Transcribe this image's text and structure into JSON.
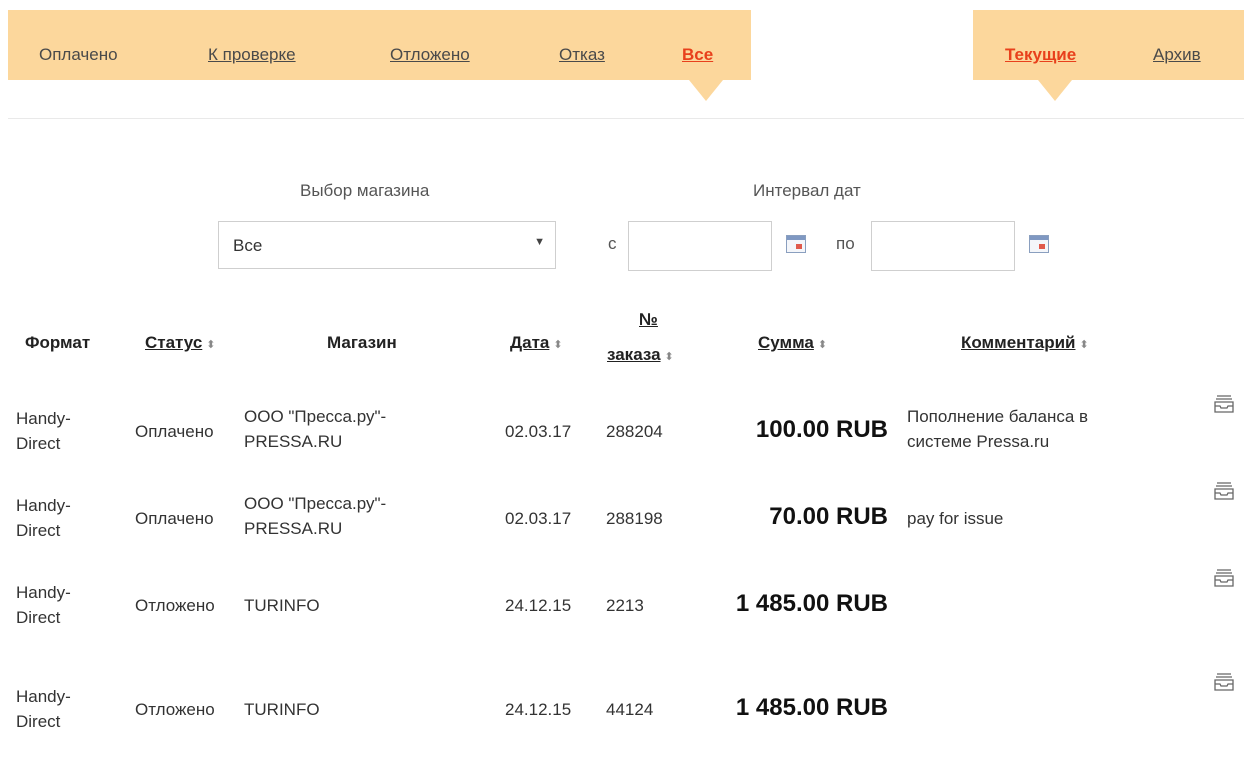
{
  "status_tabs": [
    {
      "label": "Оплачено",
      "active": false
    },
    {
      "label": "К проверке",
      "active": false
    },
    {
      "label": "Отложено",
      "active": false
    },
    {
      "label": "Отказ",
      "active": false
    },
    {
      "label": "Все",
      "active": true
    }
  ],
  "period_tabs": [
    {
      "label": "Текущие",
      "active": true
    },
    {
      "label": "Архив",
      "active": false
    }
  ],
  "filters": {
    "shop_label": "Выбор магазина",
    "shop_value": "Все",
    "date_label": "Интервал дат",
    "from_label": "с",
    "to_label": "по",
    "from_value": "",
    "to_value": ""
  },
  "table": {
    "headers": {
      "format": "Формат",
      "status": "Статус",
      "shop": "Магазин",
      "date": "Дата",
      "order_line1": "№",
      "order_line2": "заказа",
      "sum": "Сумма",
      "comment": "Комментарий"
    },
    "sort_icon": "⬍",
    "rows": [
      {
        "format": [
          "Handy-",
          "Direct"
        ],
        "status": "Оплачено",
        "shop": [
          "ООО \"Пресса.ру\"-",
          "PRESSA.RU"
        ],
        "date": "02.03.17",
        "order": "288204",
        "sum": "100.00 RUB",
        "comment": [
          "Пополнение баланса в",
          "системе Pressa.ru"
        ]
      },
      {
        "format": [
          "Handy-",
          "Direct"
        ],
        "status": "Оплачено",
        "shop": [
          "ООО \"Пресса.ру\"-",
          "PRESSA.RU"
        ],
        "date": "02.03.17",
        "order": "288198",
        "sum": "70.00 RUB",
        "comment": [
          "pay for issue"
        ]
      },
      {
        "format": [
          "Handy-",
          "Direct"
        ],
        "status": "Отложено",
        "shop": [
          "TURINFO"
        ],
        "date": "24.12.15",
        "order": "2213",
        "sum": "1 485.00 RUB",
        "comment": []
      },
      {
        "format": [
          "Handy-",
          "Direct"
        ],
        "status": "Отложено",
        "shop": [
          "TURINFO"
        ],
        "date": "24.12.15",
        "order": "44124",
        "sum": "1 485.00 RUB",
        "comment": []
      }
    ]
  },
  "icons": {
    "calendar": "calendar-icon",
    "archive": "archive-tray-icon"
  },
  "colors": {
    "tab_bg": "#fcd79c",
    "active_tab": "#e8401c"
  }
}
